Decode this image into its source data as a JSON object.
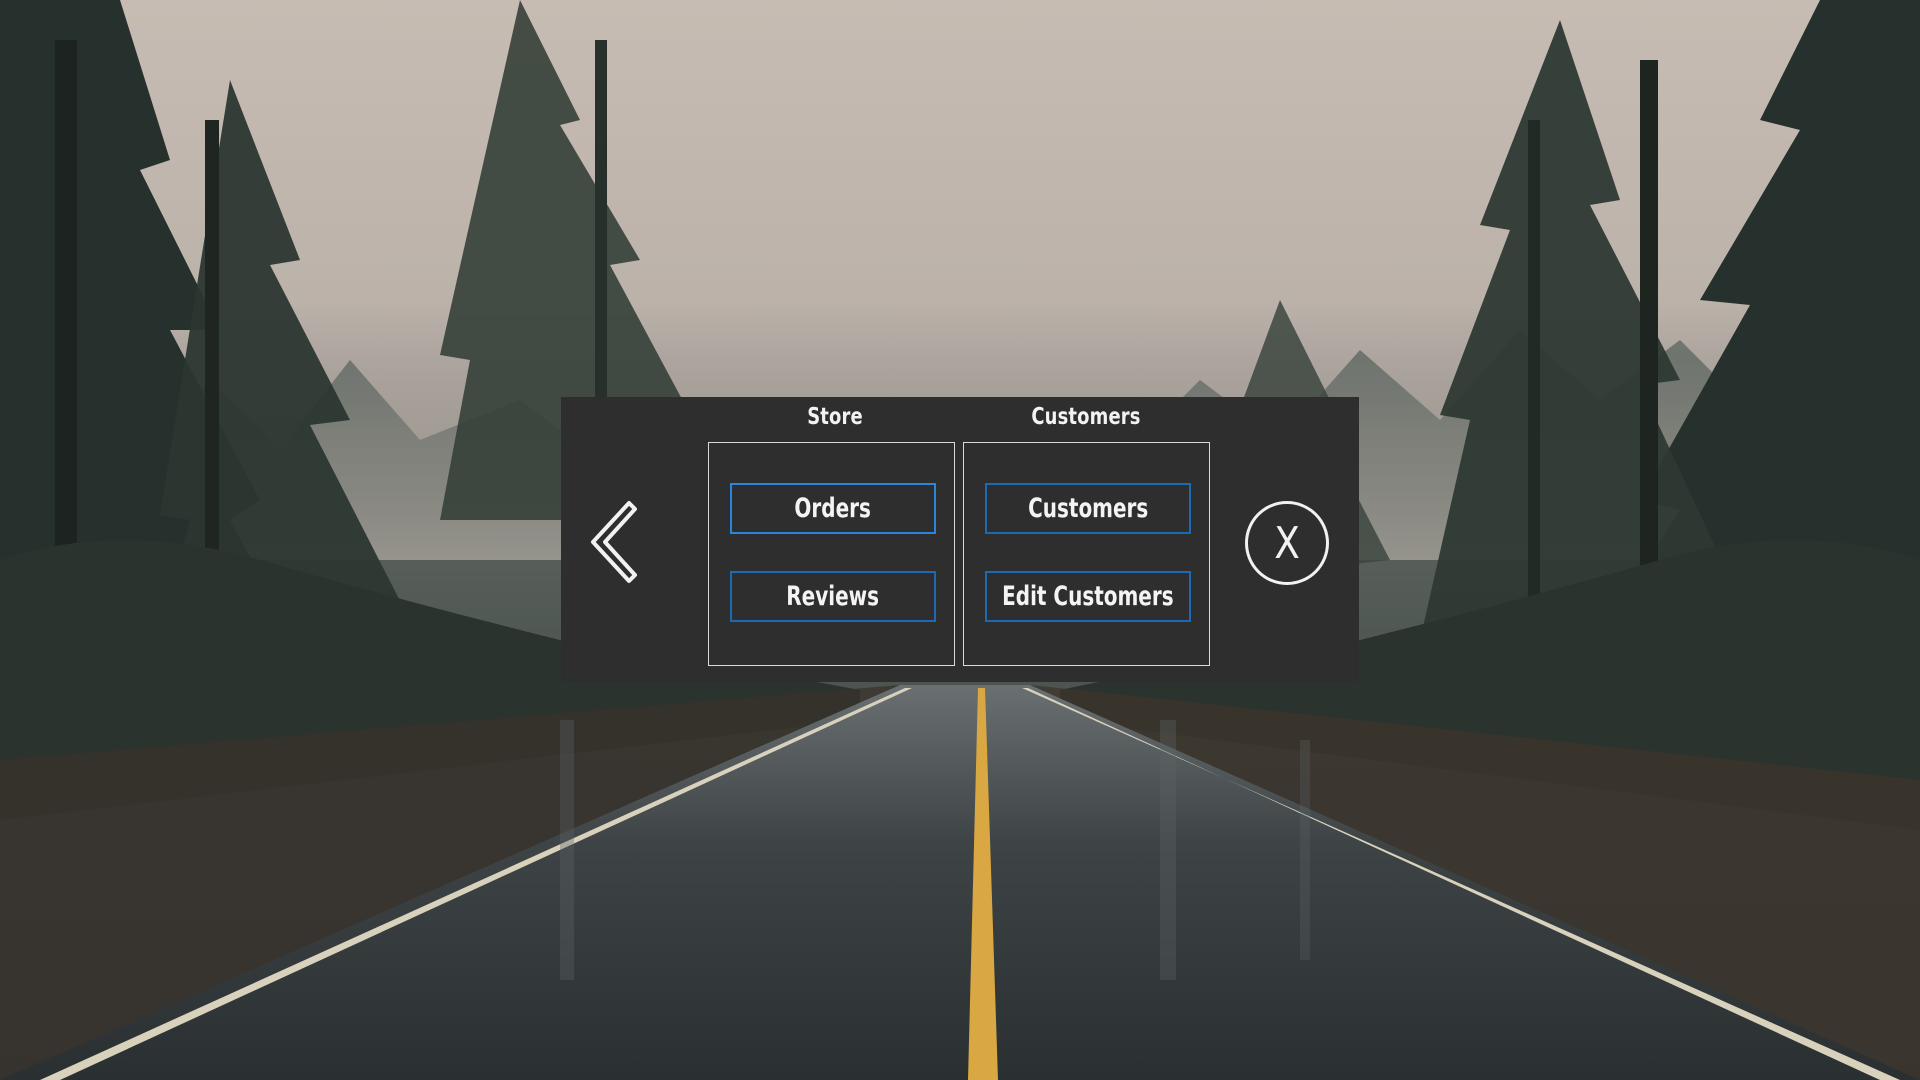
{
  "menu": {
    "back_icon": "chevron-left-icon",
    "close_label": "X",
    "groups": [
      {
        "title": "Store",
        "buttons": [
          "Orders",
          "Reviews"
        ]
      },
      {
        "title": "Customers",
        "buttons": [
          "Customers",
          "Edit Customers"
        ]
      }
    ]
  },
  "colors": {
    "panel": "#2e2e2e",
    "button_border": "#1e78c8",
    "text": "#f2f2f2"
  }
}
